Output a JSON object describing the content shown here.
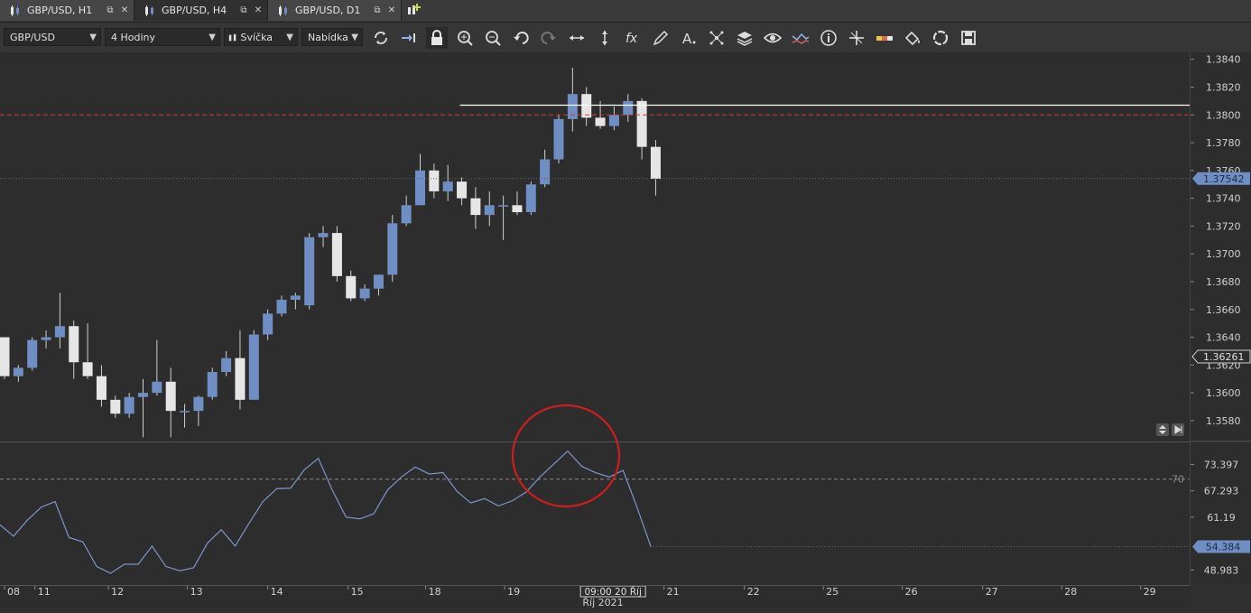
{
  "tabs": [
    {
      "label": "GBP/USD, H1",
      "active": false
    },
    {
      "label": "GBP/USD, H4",
      "active": true
    },
    {
      "label": "GBP/USD, D1",
      "active": false
    }
  ],
  "toolbar": {
    "symbol": "GBP/USD",
    "timeframe": "4 Hodiny",
    "chart_type": "Svíčka",
    "menu": "Nabídka",
    "tools": [
      "refresh-icon",
      "scroll-end-icon",
      "lock-icon",
      "zoom-in-icon",
      "zoom-out-icon",
      "undo-icon",
      "redo-icon",
      "horizontal-resize-icon",
      "vertical-resize-icon",
      "function-icon",
      "pencil-icon",
      "text-icon",
      "scatter-icon",
      "layers-icon",
      "eye-icon",
      "indicator-icon",
      "info-icon",
      "crosshair-icon",
      "ruler-icon",
      "fill-icon",
      "cycle-icon",
      "save-icon"
    ]
  },
  "colors": {
    "bull": "#6f8fc4",
    "bear": "#e6e6e6",
    "wick": "#d0d0d0",
    "hline": "#ffffff",
    "red_line": "#d33a3a",
    "rsi": "#7d95c8",
    "badge": "#6f8fc4",
    "circle": "#cc1e1e"
  },
  "chart_data": [
    {
      "type": "candlestick",
      "y_ticks": [
        "1.3840",
        "1.3820",
        "1.3800",
        "1.3780",
        "1.3760",
        "1.3740",
        "1.3720",
        "1.3700",
        "1.3680",
        "1.3660",
        "1.3640",
        "1.3620",
        "1.3600",
        "1.3580"
      ],
      "y_tick_values": [
        1.384,
        1.382,
        1.38,
        1.378,
        1.376,
        1.374,
        1.372,
        1.37,
        1.368,
        1.366,
        1.364,
        1.362,
        1.36,
        1.358
      ],
      "ylim": [
        1.3565,
        1.3845
      ],
      "price_badges": [
        {
          "label": "1.37542",
          "value": 1.37542,
          "style": "filled"
        },
        {
          "label": "1.36261",
          "value": 1.36261,
          "style": "outline"
        }
      ],
      "horizontal_line": 1.3807,
      "horizontal_line_start_index": 33,
      "red_dashed_line": 1.38,
      "candles": [
        {
          "o": 1.364,
          "h": 1.364,
          "l": 1.361,
          "c": 1.3612
        },
        {
          "o": 1.3612,
          "h": 1.362,
          "l": 1.3608,
          "c": 1.3618
        },
        {
          "o": 1.3618,
          "h": 1.364,
          "l": 1.3616,
          "c": 1.3638
        },
        {
          "o": 1.3638,
          "h": 1.3645,
          "l": 1.3632,
          "c": 1.364
        },
        {
          "o": 1.364,
          "h": 1.3672,
          "l": 1.3632,
          "c": 1.3648
        },
        {
          "o": 1.3648,
          "h": 1.3652,
          "l": 1.361,
          "c": 1.3622
        },
        {
          "o": 1.3622,
          "h": 1.365,
          "l": 1.361,
          "c": 1.3612
        },
        {
          "o": 1.3612,
          "h": 1.362,
          "l": 1.359,
          "c": 1.3595
        },
        {
          "o": 1.3595,
          "h": 1.3598,
          "l": 1.3582,
          "c": 1.3585
        },
        {
          "o": 1.3585,
          "h": 1.36,
          "l": 1.3582,
          "c": 1.3597
        },
        {
          "o": 1.3597,
          "h": 1.361,
          "l": 1.3568,
          "c": 1.36
        },
        {
          "o": 1.36,
          "h": 1.3638,
          "l": 1.3598,
          "c": 1.3608
        },
        {
          "o": 1.3608,
          "h": 1.3618,
          "l": 1.3568,
          "c": 1.3587
        },
        {
          "o": 1.3587,
          "h": 1.3592,
          "l": 1.3575,
          "c": 1.3587
        },
        {
          "o": 1.3587,
          "h": 1.3598,
          "l": 1.3576,
          "c": 1.3597
        },
        {
          "o": 1.3597,
          "h": 1.3618,
          "l": 1.3595,
          "c": 1.3615
        },
        {
          "o": 1.3615,
          "h": 1.363,
          "l": 1.3612,
          "c": 1.3625
        },
        {
          "o": 1.3625,
          "h": 1.3645,
          "l": 1.3588,
          "c": 1.3595
        },
        {
          "o": 1.3595,
          "h": 1.3645,
          "l": 1.3595,
          "c": 1.3642
        },
        {
          "o": 1.3642,
          "h": 1.366,
          "l": 1.3638,
          "c": 1.3657
        },
        {
          "o": 1.3657,
          "h": 1.367,
          "l": 1.3655,
          "c": 1.3667
        },
        {
          "o": 1.3667,
          "h": 1.3672,
          "l": 1.366,
          "c": 1.367
        },
        {
          "o": 1.3663,
          "h": 1.3715,
          "l": 1.366,
          "c": 1.3712
        },
        {
          "o": 1.3712,
          "h": 1.372,
          "l": 1.3705,
          "c": 1.3715
        },
        {
          "o": 1.3715,
          "h": 1.372,
          "l": 1.368,
          "c": 1.3684
        },
        {
          "o": 1.3684,
          "h": 1.3688,
          "l": 1.3666,
          "c": 1.3668
        },
        {
          "o": 1.3668,
          "h": 1.3678,
          "l": 1.3666,
          "c": 1.3675
        },
        {
          "o": 1.3675,
          "h": 1.3685,
          "l": 1.367,
          "c": 1.3685
        },
        {
          "o": 1.3685,
          "h": 1.3728,
          "l": 1.368,
          "c": 1.3722
        },
        {
          "o": 1.3722,
          "h": 1.3742,
          "l": 1.372,
          "c": 1.3735
        },
        {
          "o": 1.3735,
          "h": 1.3772,
          "l": 1.3735,
          "c": 1.376
        },
        {
          "o": 1.376,
          "h": 1.3765,
          "l": 1.374,
          "c": 1.3745
        },
        {
          "o": 1.3745,
          "h": 1.3764,
          "l": 1.3738,
          "c": 1.3752
        },
        {
          "o": 1.3752,
          "h": 1.3755,
          "l": 1.3735,
          "c": 1.374
        },
        {
          "o": 1.374,
          "h": 1.3748,
          "l": 1.3718,
          "c": 1.3728
        },
        {
          "o": 1.3728,
          "h": 1.3745,
          "l": 1.372,
          "c": 1.3735
        },
        {
          "o": 1.3735,
          "h": 1.3742,
          "l": 1.371,
          "c": 1.3735
        },
        {
          "o": 1.3735,
          "h": 1.3745,
          "l": 1.3728,
          "c": 1.373
        },
        {
          "o": 1.373,
          "h": 1.3752,
          "l": 1.3728,
          "c": 1.375
        },
        {
          "o": 1.375,
          "h": 1.3775,
          "l": 1.3748,
          "c": 1.3768
        },
        {
          "o": 1.3768,
          "h": 1.38,
          "l": 1.3765,
          "c": 1.3797
        },
        {
          "o": 1.3797,
          "h": 1.3834,
          "l": 1.3788,
          "c": 1.3815
        },
        {
          "o": 1.3815,
          "h": 1.382,
          "l": 1.3792,
          "c": 1.3798
        },
        {
          "o": 1.3798,
          "h": 1.381,
          "l": 1.379,
          "c": 1.3792
        },
        {
          "o": 1.3792,
          "h": 1.3806,
          "l": 1.3789,
          "c": 1.38
        },
        {
          "o": 1.38,
          "h": 1.3815,
          "l": 1.3795,
          "c": 1.381
        },
        {
          "o": 1.381,
          "h": 1.3812,
          "l": 1.3768,
          "c": 1.3777
        },
        {
          "o": 1.3777,
          "h": 1.3782,
          "l": 1.3742,
          "c": 1.3754
        }
      ]
    },
    {
      "type": "line",
      "indicator": "RSI",
      "y_ticks": [
        "73.397",
        "67.293",
        "61.19",
        "48.983"
      ],
      "y_tick_values": [
        73.397,
        67.293,
        61.19,
        48.983
      ],
      "ylim": [
        45.5,
        78.5
      ],
      "level": 70,
      "level_label": "70",
      "value_badge": {
        "label": "54.384",
        "value": 54.384
      },
      "values": [
        59.5,
        56.8,
        60.5,
        63.5,
        64.8,
        56.5,
        55.5,
        49.8,
        48.2,
        50.3,
        50.3,
        54.5,
        49.8,
        48.8,
        49.5,
        55.2,
        58.3,
        54.5,
        59.8,
        64.8,
        67.8,
        67.9,
        72.2,
        74.8,
        67.5,
        61.2,
        60.8,
        62.0,
        67.5,
        70.5,
        72.8,
        71.2,
        71.5,
        67.2,
        64.5,
        65.5,
        63.8,
        65.0,
        67.0,
        70.5,
        73.5,
        76.5,
        73.0,
        71.5,
        70.5,
        72.0,
        63.5,
        54.384
      ]
    }
  ],
  "time_axis": {
    "labels": [
      {
        "text": "08",
        "index": 0
      },
      {
        "text": "11",
        "index": 2.2
      },
      {
        "text": "12",
        "index": 7.5
      },
      {
        "text": "13",
        "index": 13.2
      },
      {
        "text": "14",
        "index": 19
      },
      {
        "text": "15",
        "index": 24.8
      },
      {
        "text": "18",
        "index": 30.4
      },
      {
        "text": "19",
        "index": 36.1
      },
      {
        "text": "21",
        "index": 47.6
      },
      {
        "text": "22",
        "index": 53.4
      },
      {
        "text": "25",
        "index": 59.1
      },
      {
        "text": "26",
        "index": 64.8
      },
      {
        "text": "27",
        "index": 70.6
      },
      {
        "text": "28",
        "index": 76.3
      },
      {
        "text": "29",
        "index": 82
      }
    ],
    "cursor_label": {
      "text": "09:00 20 Říj",
      "index": 41.9
    },
    "month_label": {
      "text": "Říj 2021",
      "index": 41.5
    }
  }
}
